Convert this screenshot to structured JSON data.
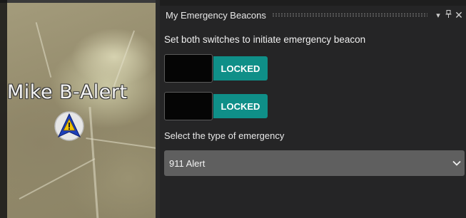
{
  "map": {
    "marker_label": "Mike B-Alert",
    "marker_icon": "alert-navigation-marker-icon"
  },
  "panel": {
    "title": "My Emergency Beacons",
    "header_icons": [
      "dropdown-arrow-icon",
      "pin-icon",
      "close-icon"
    ],
    "instruction": "Set both switches to initiate emergency beacon",
    "switches": [
      {
        "state_label": "LOCKED"
      },
      {
        "state_label": "LOCKED"
      }
    ],
    "emergency_type_label": "Select the type of emergency",
    "emergency_type": {
      "selected": "911 Alert"
    }
  },
  "colors": {
    "locked_accent": "#0f8f88",
    "panel_background": "#252526",
    "dropdown_background": "#5f5f5f"
  }
}
